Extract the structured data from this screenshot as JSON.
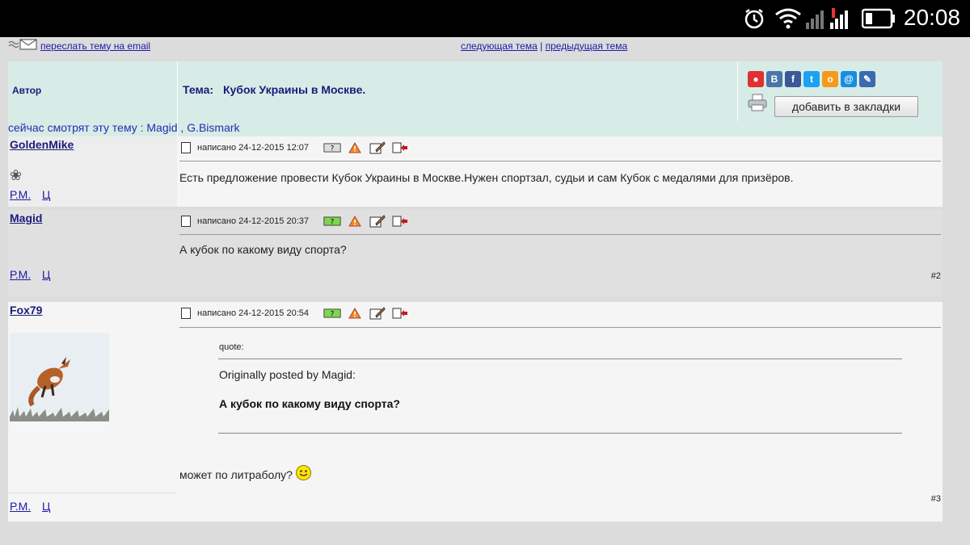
{
  "status_bar": {
    "time": "20:08",
    "icons": [
      "alarm-icon",
      "wifi-icon",
      "signal-icon",
      "signal-icon",
      "battery-icon"
    ]
  },
  "nav": {
    "email_link": "переслать тему на email",
    "next_topic": "следующая тема",
    "separator": "|",
    "prev_topic": "предыдущая тема"
  },
  "header": {
    "author_label": "Автор",
    "topic_label": "Тема:",
    "topic_title": "Кубок Украины в Москве.",
    "share_icons": [
      {
        "name": "yandex-icon",
        "glyph": "●",
        "color": "#e03030"
      },
      {
        "name": "vk-icon",
        "glyph": "В",
        "color": "#4a76a8"
      },
      {
        "name": "facebook-icon",
        "glyph": "f",
        "color": "#3b5998"
      },
      {
        "name": "twitter-icon",
        "glyph": "t",
        "color": "#1da1f2"
      },
      {
        "name": "odnoklassniki-icon",
        "glyph": "о",
        "color": "#f59a1a"
      },
      {
        "name": "mailru-icon",
        "glyph": "@",
        "color": "#168de2"
      },
      {
        "name": "livejournal-icon",
        "glyph": "✎",
        "color": "#3a6ab0"
      }
    ],
    "bookmark_button": "добавить в закладки"
  },
  "viewers_text": "сейчас смотрят эту тему : Magid , G.Bismark",
  "posts": [
    {
      "author": "GoldenMike",
      "posted": "написано 24-12-2015 12:07",
      "text": "Есть предложение провести Кубок Украины в Москве.Нужен спортзал, судьи и сам Кубок с медалями для призёров.",
      "pm": "Р.М.",
      "profile": "Ц",
      "number": ""
    },
    {
      "author": "Magid",
      "posted": "написано 24-12-2015 20:37",
      "text": "А кубок по какому виду спорта?",
      "pm": "Р.М.",
      "profile": "Ц",
      "number": "#2"
    },
    {
      "author": "Fox79",
      "posted": "написано 24-12-2015 20:54",
      "quote_label": "quote:",
      "quote_author": "Originally posted by Magid:",
      "quote_text": "А кубок по какому виду спорта?",
      "text": "может по литраболу?",
      "pm": "Р.М.",
      "profile": "Ц",
      "number": "#3"
    }
  ],
  "colors": {
    "header_bg": "#d7ece6",
    "link": "#1a1aa6",
    "title": "#1b1b7a"
  }
}
